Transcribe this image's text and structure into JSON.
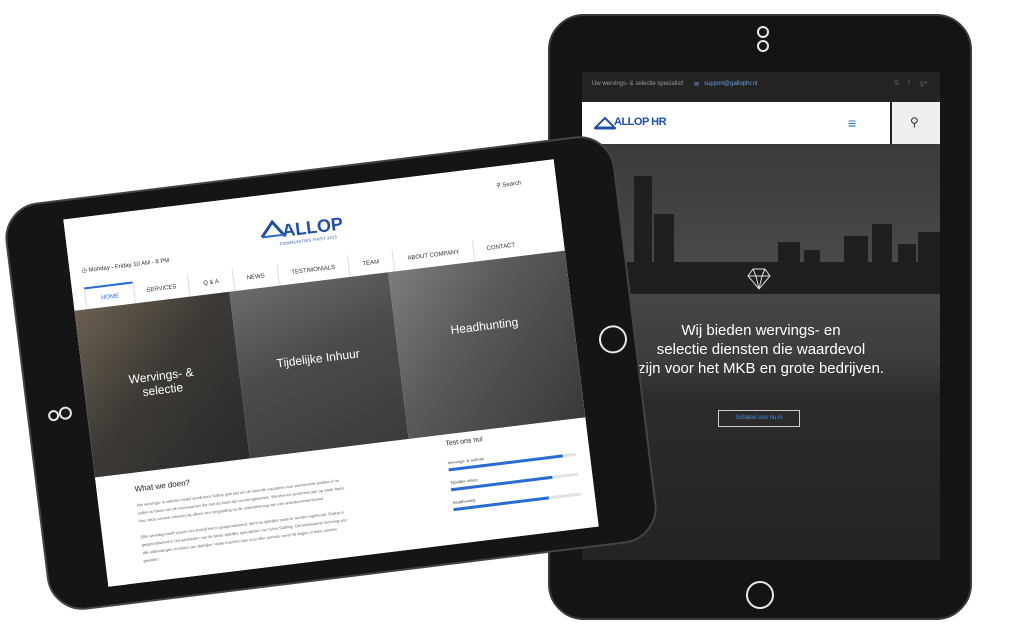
{
  "tablet_left": {
    "hours": "Monday - Friday 10 AM - 8 PM",
    "logo": {
      "name": "ALLOP",
      "tagline": "COMMUNITIES FIRST 2015"
    },
    "search_label": "Search",
    "nav": [
      "HOME",
      "SERVICES",
      "Q & A",
      "NEWS",
      "TESTIMONIALS",
      "TEAM",
      "ABOUT COMPANY",
      "CONTACT"
    ],
    "panels": [
      {
        "line1": "Wervings- &",
        "line2": "selectie"
      },
      {
        "line1": "Tijdelijke Inhuur",
        "line2": ""
      },
      {
        "line1": "Headhunting",
        "line2": ""
      }
    ],
    "what": {
      "title": "What we doen?",
      "lines": [
        "Het wervings- & selectie model wordt door Gallop gebruikt om de lopende vacatures voor permanente posities in te",
        "vullen op basis van de voorwaarden die met de klant zijn overeengekomen. We leveren personeel aan op vaste basis.",
        "Voor deze service rekenen wij alleen een vergoeding na de ondertekening van een arbeidsovereenkomst.",
        "",
        "Elke werkdag heeft waarin een bedrijf niet is gespecialiseerd, dient op tijdelijke basis te worden ingehuurd. Gallop is",
        "gespecialiseerd in het aanbieden van de beste tijdelijke specialisten via Turbo Staffing. Gecombineerde factoring van",
        "alle uitbetalingen of inhuur van tijdelijke / vaste krachten kan voor elke periode vanaf 30 dagen of meer worden",
        "gesloten."
      ]
    },
    "test": {
      "title": "Test ons nu!",
      "bars": [
        {
          "label": "Wervings- & selectie",
          "level": 0.9
        },
        {
          "label": "Tijdelijke inhuur",
          "level": 0.8
        },
        {
          "label": "Headhunting",
          "level": 0.75
        }
      ]
    }
  },
  "tablet_right": {
    "topbar_text": "Uw wervings- & selectie specialist!",
    "email": "support@gallophr.nl",
    "social_icons": [
      "skype-icon",
      "facebook-icon",
      "google-plus-icon"
    ],
    "logo": "ALLOP HR",
    "hero": {
      "line1": "Wij bieden wervings- en",
      "line2": "selectie diensten die waardevol",
      "line3": "zijn voor het MKB en grote bedrijven."
    },
    "cta": "Schakel ons nu in"
  },
  "colors": {
    "brand": "#1f4fa8",
    "accent": "#2a6cd6"
  }
}
